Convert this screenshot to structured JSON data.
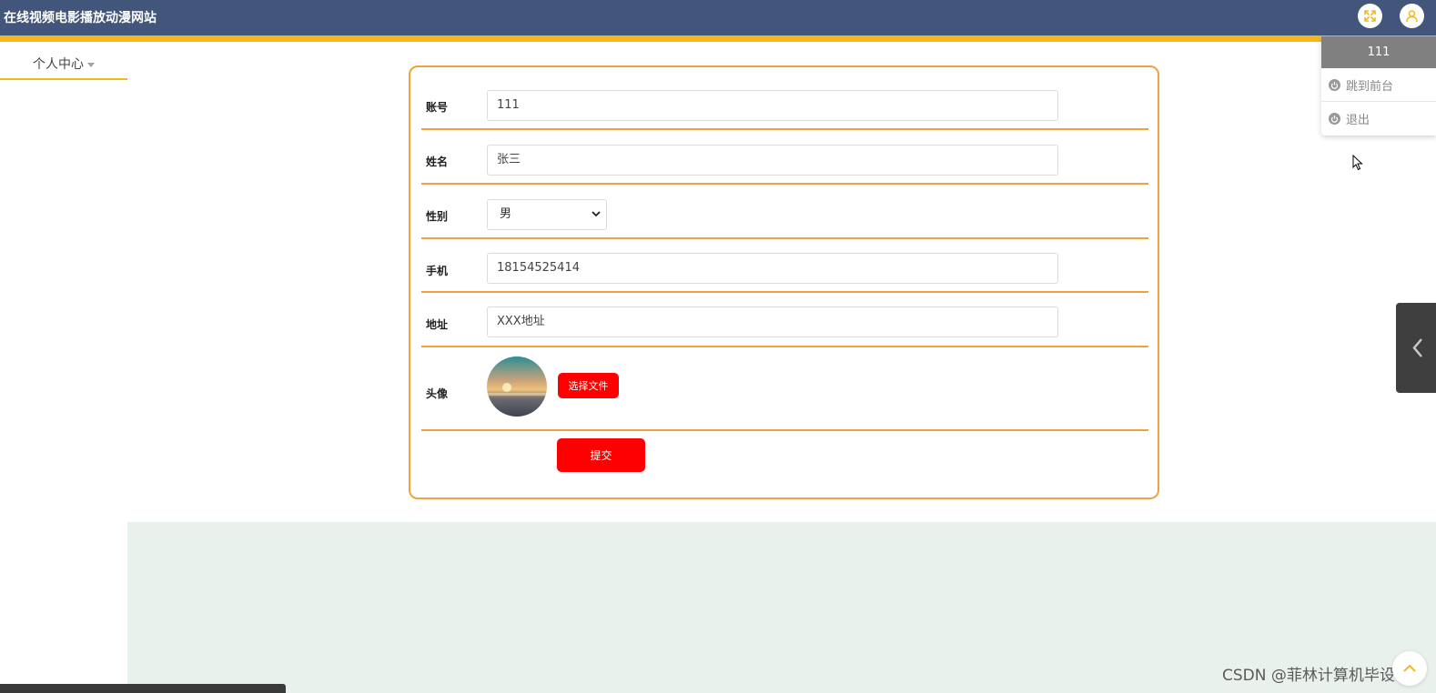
{
  "header": {
    "site_title": "在线视频电影播放动漫网站",
    "fullscreen_icon": "expand-arrows-icon",
    "user_icon": "user-icon"
  },
  "colors": {
    "header_bg": "#42567c",
    "accent_yellow": "#f6b71a",
    "form_border": "#f0a23c",
    "button_red": "#ff0000",
    "bottom_area": "#e8f1ec"
  },
  "sidebar": {
    "menu_label": "个人中心"
  },
  "form": {
    "account": {
      "label": "账号",
      "value": "111"
    },
    "name": {
      "label": "姓名",
      "value": "张三"
    },
    "gender": {
      "label": "性别",
      "value": "男"
    },
    "phone": {
      "label": "手机",
      "value": "18154525414"
    },
    "address": {
      "label": "地址",
      "value": "XXX地址"
    },
    "avatar": {
      "label": "头像",
      "choose_file_label": "选择文件"
    },
    "submit_label": "提交"
  },
  "user_dropdown": {
    "username": "111",
    "items": [
      {
        "label": "跳到前台",
        "icon": "power-icon"
      },
      {
        "label": "退出",
        "icon": "power-icon"
      }
    ]
  },
  "watermark": "CSDN @菲林计算机毕设"
}
